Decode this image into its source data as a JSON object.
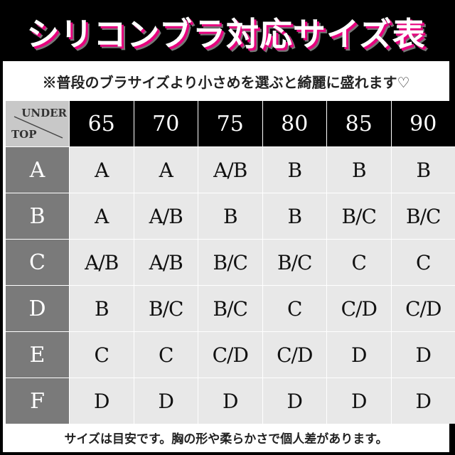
{
  "title": "シリコンブラ対応サイズ表",
  "note": "※普段のブラサイズより小さめを選ぶと綺麗に盛れます♡",
  "table": {
    "corner": {
      "col_axis_label": "UNDER",
      "row_axis_label": "TOP"
    },
    "columns": [
      "65",
      "70",
      "75",
      "80",
      "85",
      "90"
    ],
    "rows": [
      {
        "label": "A",
        "cells": [
          "A",
          "A",
          "A/B",
          "B",
          "B",
          "B"
        ]
      },
      {
        "label": "B",
        "cells": [
          "A",
          "A/B",
          "B",
          "B",
          "B/C",
          "B/C"
        ]
      },
      {
        "label": "C",
        "cells": [
          "A/B",
          "A/B",
          "B/C",
          "B/C",
          "C",
          "C"
        ]
      },
      {
        "label": "D",
        "cells": [
          "B",
          "B/C",
          "B/C",
          "C",
          "C/D",
          "C/D"
        ]
      },
      {
        "label": "E",
        "cells": [
          "C",
          "C",
          "C/D",
          "C/D",
          "D",
          "D"
        ]
      },
      {
        "label": "F",
        "cells": [
          "D",
          "D",
          "D",
          "D",
          "D",
          "D"
        ]
      }
    ]
  },
  "footer": "サイズは目安です。胸の形や柔らかさで個人差があります。",
  "colors": {
    "title_bg": "#000000",
    "title_shadow_accent": "#e6007e",
    "header_bg": "#000000",
    "row_header_bg": "#7a7a7a",
    "corner_bg": "#c8c8c8",
    "cell_bg": "#e8e8e8"
  }
}
